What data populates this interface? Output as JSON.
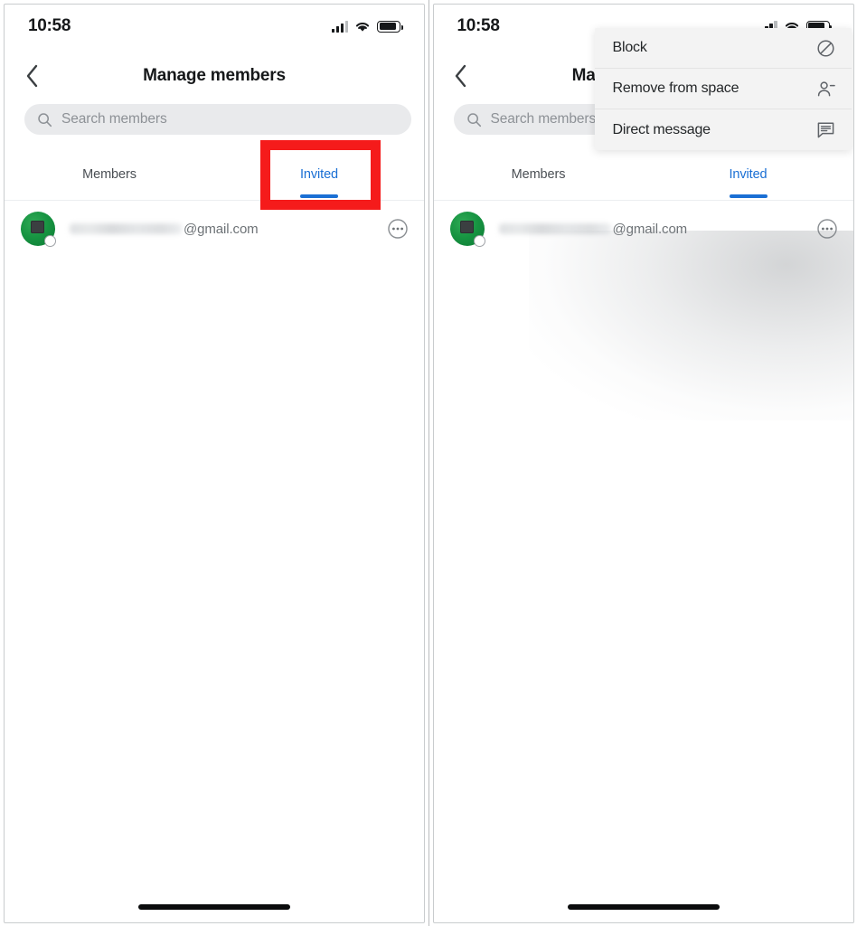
{
  "screen": {
    "status": {
      "time": "10:58",
      "signal_icon": "signal-bars-icon",
      "wifi_icon": "wifi-icon",
      "battery_icon": "battery-icon"
    },
    "nav": {
      "back_icon": "back-chevron-icon",
      "title": "Manage members"
    },
    "search": {
      "icon": "search-icon",
      "placeholder": "Search members",
      "value": ""
    },
    "tabs": [
      {
        "label": "Members",
        "active": false
      },
      {
        "label": "Invited",
        "active": true
      }
    ],
    "member": {
      "avatar_icon": "avatar-image",
      "status_icon": "presence-status-icon",
      "name": "",
      "email": "@gmail.com",
      "more_icon": "more-options-icon"
    },
    "context_menu": {
      "items": [
        {
          "label": "Block",
          "icon": "block-icon"
        },
        {
          "label": "Remove from space",
          "icon": "person-remove-icon"
        },
        {
          "label": "Direct message",
          "icon": "chat-bubble-icon"
        }
      ]
    },
    "home_indicator": "home-indicator"
  },
  "colors": {
    "accent_blue": "#1a6fd4",
    "highlight_red": "#f51b1b",
    "avatar_green": "#169341",
    "search_bg": "#e9eaec",
    "menu_bg": "#f3f3f3",
    "text_primary": "#16181a",
    "text_secondary": "#6d7276"
  },
  "annotations": [
    {
      "name": "invited-tab-highlight",
      "target": "Invited tab"
    },
    {
      "name": "context-menu-highlight",
      "target": "context menu"
    }
  ]
}
